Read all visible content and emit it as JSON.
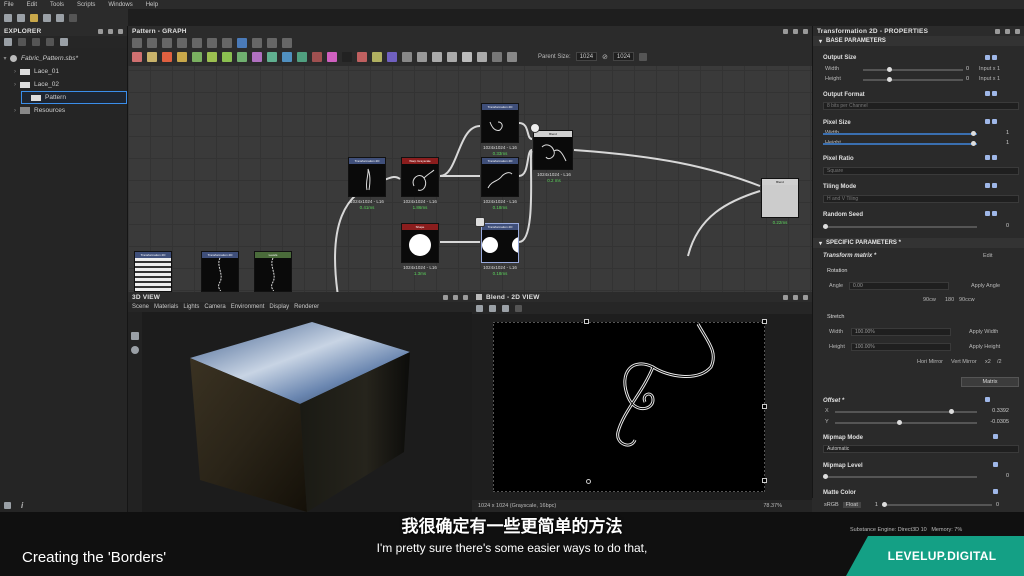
{
  "menu": [
    "File",
    "Edit",
    "Tools",
    "Scripts",
    "Windows",
    "Help"
  ],
  "explorer": {
    "title": "EXPLORER",
    "items": [
      {
        "label": "Fabric_Pattern.sbs*",
        "type": "package"
      },
      {
        "label": "Lace_01",
        "type": "graph"
      },
      {
        "label": "Lace_02",
        "type": "graph"
      },
      {
        "label": "Pattern",
        "type": "graph",
        "selected": true
      },
      {
        "label": "Resources",
        "type": "folder"
      }
    ]
  },
  "graph": {
    "title": "Pattern - GRAPH",
    "parent_size_label": "Parent Size:",
    "parent_size_a": "1024",
    "parent_size_b": "1024",
    "nodes": [
      {
        "id": "n1",
        "header": "Transformation 2D",
        "color": "#3f4f7a",
        "caption": "1024x1024 - L16",
        "time": "0.41ms"
      },
      {
        "id": "n2",
        "header": "Warp Grayscale",
        "color": "#8b1d1d",
        "caption": "1024x1024 - L16",
        "time": "1.86ms"
      },
      {
        "id": "n3",
        "header": "Transformation 2D",
        "color": "#3f4f7a",
        "caption": "1024x1024 - L16",
        "time": "0.33ms"
      },
      {
        "id": "n4",
        "header": "Transformation 2D",
        "color": "#3f4f7a",
        "caption": "1024x1024 - L16",
        "time": "0.18ms"
      },
      {
        "id": "n5",
        "header": "Blend",
        "color": "#d0d0d0",
        "caption": "1024x1024 - L16",
        "time": "0.2 ms"
      },
      {
        "id": "n6",
        "header": "Shape",
        "color": "#8b1d1d",
        "caption": "1024x1024 - L16",
        "time": "1.3ms"
      },
      {
        "id": "n7",
        "header": "Transformation 2D",
        "color": "#3f4f7a",
        "caption": "1024x1024 - L16",
        "time": "0.18ms"
      },
      {
        "id": "n8",
        "header": "Blend",
        "color": "#d0d0d0",
        "caption": "",
        "time": "0.22ms"
      },
      {
        "id": "n9",
        "header": "Transformation 2D",
        "color": "#3f4f7a",
        "caption": "",
        "time": ""
      },
      {
        "id": "n10",
        "header": "Transformation 2D",
        "color": "#3f4f7a",
        "caption": "",
        "time": ""
      },
      {
        "id": "n11",
        "header": "Levels",
        "color": "#4a6b3a",
        "caption": "",
        "time": ""
      }
    ]
  },
  "view3d": {
    "title": "3D VIEW",
    "menu": [
      "Scene",
      "Materials",
      "Lights",
      "Camera",
      "Environment",
      "Display",
      "Renderer"
    ]
  },
  "view2d": {
    "title": "Blend - 2D VIEW",
    "status": "1024 x 1024 (Grayscale, 16bpc)",
    "zoom": "78.37%"
  },
  "properties": {
    "title": "Transformation 2D - PROPERTIES",
    "base_section": "BASE PARAMETERS",
    "output_size": "Output Size",
    "width": "Width",
    "height": "Height",
    "width_val": "0",
    "height_val": "0",
    "width_rel": "Input x 1",
    "height_rel": "Input x 1",
    "output_format": "Output Format",
    "output_format_val": "8 bits per Channel",
    "pixel_size": "Pixel Size",
    "px_w_val": "1",
    "px_h_val": "1",
    "pixel_ratio": "Pixel Ratio",
    "pixel_ratio_val": "Square",
    "tiling_mode": "Tiling Mode",
    "tiling_mode_val": "H and V Tiling",
    "random_seed": "Random Seed",
    "random_seed_val": "0",
    "specific_section": "SPECIFIC PARAMETERS *",
    "transform_matrix": "Transform matrix *",
    "edit": "Edit",
    "rotation": "Rotation",
    "angle": "Angle",
    "angle_val": "0.00",
    "apply_angle": "Apply Angle",
    "rot_90cw": "90cw",
    "rot_180": "180",
    "rot_90ccw": "90ccw",
    "stretch": "Stretch",
    "stretch_width": "Width",
    "stretch_width_val": "100.00%",
    "apply_width": "Apply Width",
    "stretch_height": "Height",
    "stretch_height_val": "100.00%",
    "apply_height": "Apply Height",
    "hori_mirror": "Hori Mirror",
    "vert_mirror": "Vert Mirror",
    "x2": "x2",
    "div2": "/2",
    "matrix_btn": "Matrix",
    "offset": "Offset *",
    "x_label": "X",
    "y_label": "Y",
    "offset_x": "0.3392",
    "offset_y": "-0.0305",
    "mipmap_mode": "Mipmap Mode",
    "mipmap_mode_val": "Automatic",
    "mipmap_level": "Mipmap Level",
    "mipmap_level_val": "0",
    "matte_color": "Matte Color",
    "srgb": "sRGB",
    "float": "Float",
    "matte_val": "1",
    "matte_val2": "0"
  },
  "status": {
    "engine": "Substance Engine: Direct3D 10",
    "memory": "Memory: 7%"
  },
  "subtitle_cn": "我很确定有一些更简单的方法",
  "subtitle_en": "I'm pretty sure there's some easier ways to do that,",
  "chapter": "Creating the 'Borders'",
  "brand": "LEVELUP.DIGITAL"
}
